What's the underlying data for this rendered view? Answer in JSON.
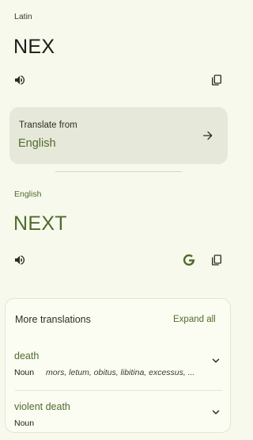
{
  "source": {
    "language": "Latin",
    "text": "NEX",
    "icons": {
      "speaker": "speaker-icon",
      "copy": "copy-icon"
    }
  },
  "translate_from": {
    "label": "Translate from",
    "value": "English",
    "icon": "arrow-right-icon"
  },
  "target": {
    "language": "English",
    "text": "NEXT",
    "icons": {
      "speaker": "speaker-icon",
      "google": "google-g-icon",
      "copy": "copy-icon"
    }
  },
  "more_translations": {
    "title": "More translations",
    "expand_label": "Expand all",
    "entries": [
      {
        "word": "death",
        "pos": "Noun",
        "synonyms": "mors, letum, obitus, libitina, excessus, ..."
      },
      {
        "word": "violent death",
        "pos": "Noun",
        "synonyms": ""
      }
    ]
  },
  "colors": {
    "background": "#f6f9ec",
    "accent": "#4f6b2b",
    "card": "#e6e8d9"
  }
}
